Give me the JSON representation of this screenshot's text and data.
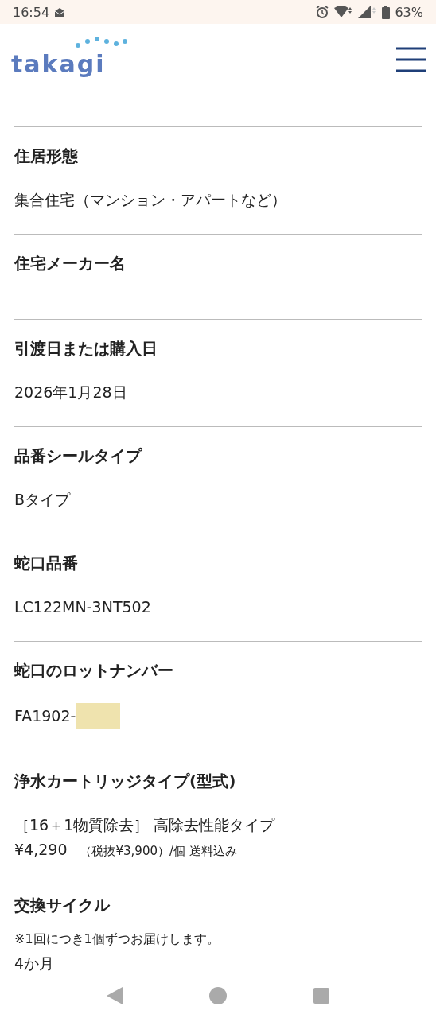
{
  "status_bar": {
    "time": "16:54",
    "battery": "63%"
  },
  "header": {
    "logo": "takagi"
  },
  "sections": [
    {
      "heading": "住居形態",
      "values": [
        "集合住宅（マンション・アパートなど）"
      ]
    },
    {
      "heading": "住宅メーカー名"
    },
    {
      "heading": "引渡日または購入日",
      "values": [
        "2026年1月28日"
      ]
    },
    {
      "heading": "品番シールタイプ",
      "values": [
        "Bタイプ"
      ]
    },
    {
      "heading": "蛇口品番",
      "values": [
        "LC122MN-3NT502"
      ]
    },
    {
      "heading": "蛇口のロットナンバー",
      "values": [
        "FA1902-"
      ],
      "redacted": true
    },
    {
      "heading": "浄水カートリッジタイプ(型式)",
      "values": [
        "［16＋1物質除去］ 高除去性能タイプ"
      ],
      "price": {
        "amount": "¥4,290",
        "note": "（税抜¥3,900）/個  送料込み"
      }
    },
    {
      "heading": "交換サイクル",
      "note": "※1回につき1個ずつお届けします。",
      "values": [
        "4か月"
      ]
    }
  ]
}
